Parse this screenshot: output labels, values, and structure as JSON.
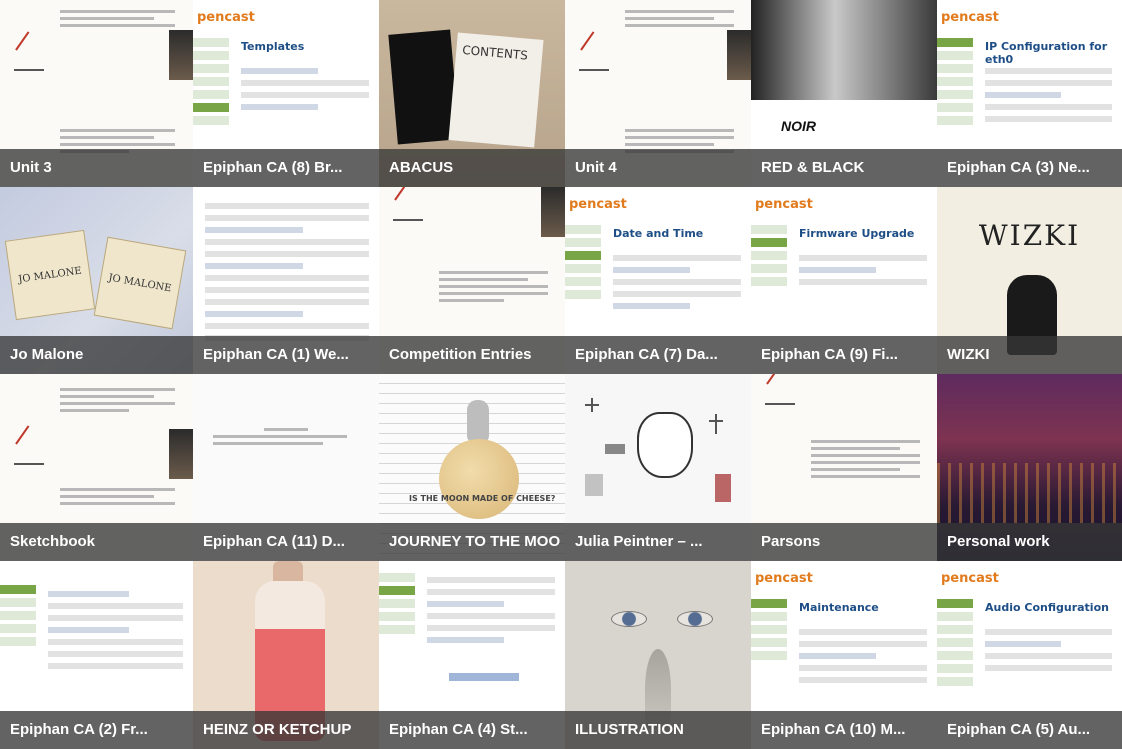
{
  "gallery": {
    "tiles": [
      {
        "caption": "Unit 3",
        "icon": "document-thumbnail"
      },
      {
        "caption": "Epiphan CA (8) Br...",
        "brand": "pencast",
        "heading": "Templates"
      },
      {
        "caption": "ABACUS",
        "page_text": "CONTENTS"
      },
      {
        "caption": "Unit 4"
      },
      {
        "caption": "RED & BLACK",
        "page_text": "NOIR"
      },
      {
        "caption": "Epiphan CA (3) Ne...",
        "brand": "pencast",
        "heading": "IP Configuration for eth0"
      },
      {
        "caption": "Jo Malone",
        "box_text": "JO MALONE"
      },
      {
        "caption": "Epiphan CA (1) We..."
      },
      {
        "caption": "Competition Entries"
      },
      {
        "caption": "Epiphan CA (7) Da...",
        "brand": "pencast",
        "heading": "Date and Time"
      },
      {
        "caption": "Epiphan CA (9) Fi...",
        "brand": "pencast",
        "heading": "Firmware Upgrade"
      },
      {
        "caption": "WIZKI",
        "logo": "WIZKI"
      },
      {
        "caption": "Sketchbook"
      },
      {
        "caption": "Epiphan CA (11) D..."
      },
      {
        "caption": "JOURNEY TO THE MOO",
        "page_text": "IS THE MOON MADE OF CHEESE?"
      },
      {
        "caption": "Julia Peintner – ..."
      },
      {
        "caption": "Parsons"
      },
      {
        "caption": "Personal work"
      },
      {
        "caption": "Epiphan CA (2) Fr..."
      },
      {
        "caption": "HEINZ OR KETCHUP"
      },
      {
        "caption": "Epiphan CA (4) St..."
      },
      {
        "caption": "ILLUSTRATION"
      },
      {
        "caption": "Epiphan CA (10) M...",
        "brand": "pencast",
        "heading": "Maintenance"
      },
      {
        "caption": "Epiphan CA (5) Au...",
        "brand": "pencast",
        "heading": "Audio Configuration"
      }
    ]
  },
  "colors": {
    "caption_bg": "#3a3a3a",
    "caption_text": "#ffffff",
    "epiphan_orange": "#e17b1d",
    "epiphan_green": "#78a545",
    "admin_title_blue": "#1e4e86"
  }
}
